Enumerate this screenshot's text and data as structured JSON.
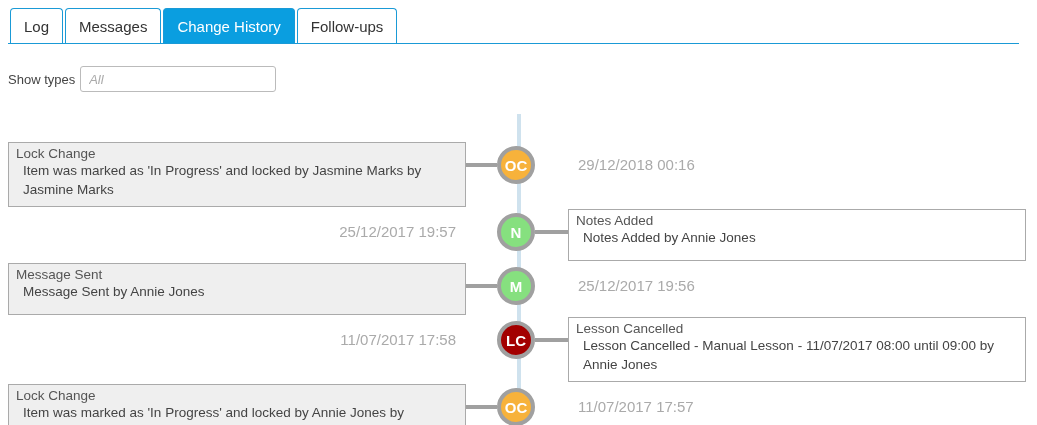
{
  "tabs": [
    {
      "label": "Log",
      "selected": false
    },
    {
      "label": "Messages",
      "selected": false
    },
    {
      "label": "Change History",
      "selected": true
    },
    {
      "label": "Follow-ups",
      "selected": false
    }
  ],
  "filter": {
    "label": "Show types",
    "placeholder": "All"
  },
  "events": [
    {
      "kind": "left",
      "title": "Lock Change",
      "description": "Item was marked as 'In Progress' and locked by Jasmine Marks by Jasmine Marks",
      "timestamp": "29/12/2018 00:16",
      "initials": "OC",
      "color": "#f7b23b"
    },
    {
      "kind": "right",
      "title": "Notes Added",
      "description": "Notes Added by Annie Jones",
      "timestamp": "25/12/2017 19:57",
      "initials": "N",
      "color": "#86e07f"
    },
    {
      "kind": "left",
      "title": "Message Sent",
      "description": "Message Sent by Annie Jones",
      "timestamp": "25/12/2017 19:56",
      "initials": "M",
      "color": "#86e07f"
    },
    {
      "kind": "right",
      "title": "Lesson Cancelled",
      "description": "Lesson Cancelled - Manual Lesson - 11/07/2017 08:00 until 09:00 by Annie Jones",
      "timestamp": "11/07/2017 17:58",
      "initials": "LC",
      "color": "#a30000"
    },
    {
      "kind": "left",
      "title": "Lock Change",
      "description": "Item was marked as 'In Progress' and locked by Annie Jones by",
      "timestamp": "11/07/2017 17:57",
      "initials": "OC",
      "color": "#f7b23b"
    }
  ]
}
